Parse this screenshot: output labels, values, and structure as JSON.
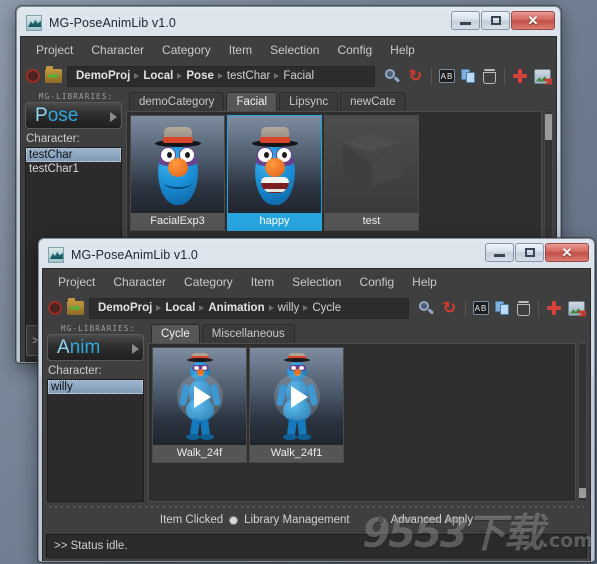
{
  "window1": {
    "title": "MG-PoseAnimLib v1.0",
    "icon": "app-icon",
    "buttons": {
      "minimize": "minimize",
      "maximize": "maximize",
      "close": "close",
      "close_glyph": "✕"
    },
    "menu": [
      "Project",
      "Character",
      "Category",
      "Item",
      "Selection",
      "Config",
      "Help"
    ],
    "toolbar": {
      "record_icon": "record-ring-icon",
      "folder_icon": "open-folder-icon",
      "breadcrumb": [
        "DemoProj",
        "Local",
        "Pose",
        "testChar",
        "Facial"
      ],
      "icons": [
        "search-icon",
        "refresh-icon",
        "rename-icon",
        "copy-icon",
        "delete-icon",
        "add-icon",
        "thumbnail-icon"
      ],
      "refresh_glyph": "↻"
    },
    "sidebar": {
      "brand_label": "MG-LIBRARIES:",
      "logo_cap": "P",
      "logo_rest": "ose",
      "character_label": "Character:",
      "characters": [
        "testChar",
        "testChar1"
      ],
      "selected_character": "testChar",
      "expander_label": ">"
    },
    "tabs": [
      "demoCategory",
      "Facial",
      "Lipsync",
      "newCate"
    ],
    "active_tab": "Facial",
    "items": [
      {
        "name": "FacialExp3",
        "selected": false,
        "thumb": "character-smile"
      },
      {
        "name": "happy",
        "selected": true,
        "thumb": "character-grin"
      },
      {
        "name": "test",
        "selected": false,
        "thumb": "cube"
      }
    ]
  },
  "window2": {
    "title": "MG-PoseAnimLib v1.0",
    "icon": "app-icon",
    "buttons": {
      "minimize": "minimize",
      "maximize": "maximize",
      "close": "close",
      "close_glyph": "✕"
    },
    "menu": [
      "Project",
      "Character",
      "Category",
      "Item",
      "Selection",
      "Config",
      "Help"
    ],
    "toolbar": {
      "record_icon": "record-ring-icon",
      "folder_icon": "open-folder-icon",
      "breadcrumb": [
        "DemoProj",
        "Local",
        "Animation",
        "willy",
        "Cycle"
      ],
      "icons": [
        "search-icon",
        "refresh-icon",
        "rename-icon",
        "copy-icon",
        "delete-icon",
        "add-icon",
        "thumbnail-icon"
      ],
      "refresh_glyph": "↻"
    },
    "sidebar": {
      "brand_label": "MG-LIBRARIES:",
      "logo_cap": "A",
      "logo_rest": "nim",
      "character_label": "Character:",
      "characters": [
        "willy"
      ],
      "selected_character": "willy"
    },
    "tabs": [
      "Cycle",
      "Miscellaneous"
    ],
    "active_tab": "Cycle",
    "items": [
      {
        "name": "Walk_24f",
        "selected": false,
        "thumb": "character-walk"
      },
      {
        "name": "Walk_24f1",
        "selected": false,
        "thumb": "character-walk"
      }
    ],
    "options": {
      "item_clicked_label": "Item Clicked",
      "library_management_label": "Library Management",
      "library_management_on": true,
      "advanced_apply_label": "Advanced Apply",
      "advanced_apply_on": false
    },
    "status": ">> Status idle."
  },
  "watermark": {
    "digits": "9553",
    "suffix": "下载",
    "domain": ".com"
  },
  "colors": {
    "accent_blue": "#27a3dd",
    "logo_blue": "#2ea9df",
    "close_red": "#c14f46",
    "add_red": "#d8403a",
    "desktop": "#6b7a8d"
  }
}
